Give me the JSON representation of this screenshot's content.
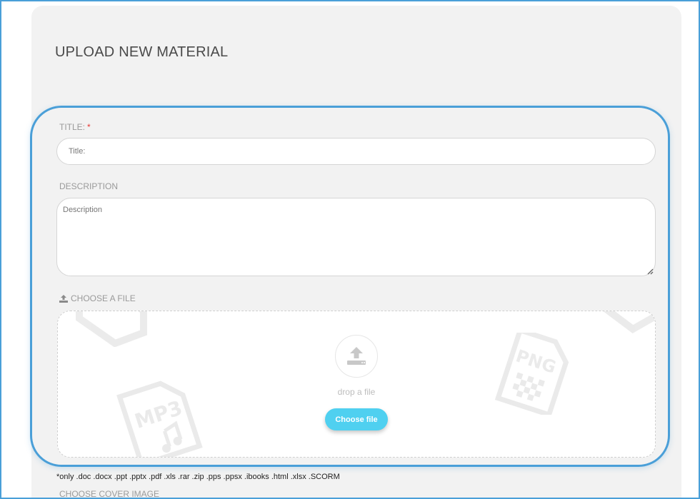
{
  "page": {
    "title": "UPLOAD NEW MATERIAL"
  },
  "form": {
    "title_field": {
      "label": "TITLE:",
      "required_mark": "*",
      "placeholder": "Title:",
      "value": ""
    },
    "description_field": {
      "label": "DESCRIPTION",
      "placeholder": "Description",
      "value": ""
    },
    "file_field": {
      "label": "CHOOSE A FILE",
      "icon": "upload-icon",
      "drop_text": "drop a file",
      "button_label": "Choose file",
      "background_icons": [
        "mp3-file-icon",
        "png-file-icon",
        "file-icon"
      ]
    },
    "formats_note": "*only .doc .docx .ppt .pptx .pdf .xls .rar .zip .pps .ppsx .ibooks .html .xlsx .SCORM",
    "cover_image_label": "CHOOSE COVER IMAGE"
  },
  "colors": {
    "accent_button": "#4fd0f0",
    "highlight_border": "#4a9fd8",
    "required": "#e53935",
    "panel_bg": "#f2f2f2"
  }
}
